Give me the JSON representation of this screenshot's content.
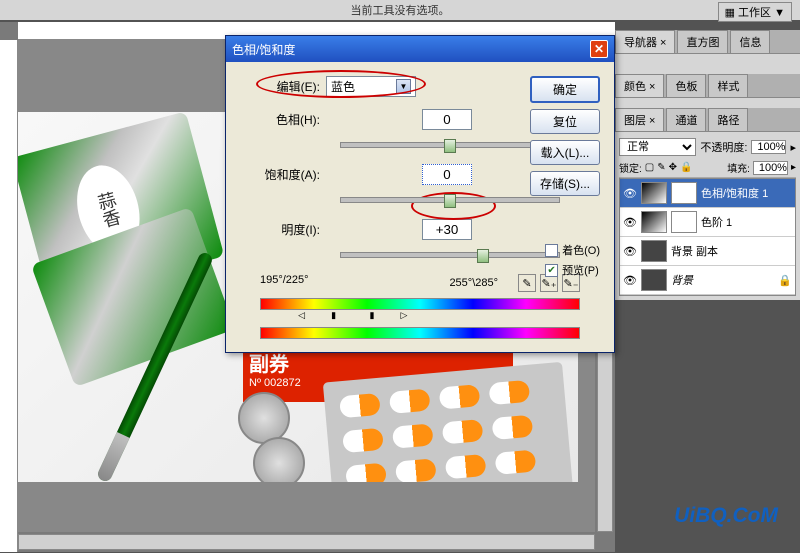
{
  "toolbar": {
    "no_options": "当前工具没有选项。",
    "workspace": "工作区 ▼"
  },
  "panel_tabs_top": [
    "导航器 ×",
    "直方图",
    "信息"
  ],
  "panel_tabs_color": [
    "颜色 ×",
    "色板",
    "样式"
  ],
  "panel_tabs_layers": [
    "图层 ×",
    "通道",
    "路径"
  ],
  "layers_panel": {
    "blend_mode": "正常",
    "opacity_label": "不透明度:",
    "opacity": "100%",
    "lock_label": "锁定:",
    "fill_label": "填充:",
    "fill": "100%",
    "layers": [
      {
        "name": "色相/饱和度 1",
        "selected": true,
        "adj": true
      },
      {
        "name": "色阶 1",
        "selected": false,
        "adj": true
      },
      {
        "name": "背景 副本",
        "selected": false,
        "adj": false
      },
      {
        "name": "背景",
        "selected": false,
        "adj": false,
        "locked": true
      }
    ]
  },
  "dialog": {
    "title": "色相/饱和度",
    "edit_label": "编辑(E):",
    "edit_value": "蓝色",
    "hue_label": "色相(H):",
    "hue_value": "0",
    "sat_label": "饱和度(A):",
    "sat_value": "0",
    "light_label": "明度(I):",
    "light_value": "+30",
    "range_left": "195°/225°",
    "range_right": "255°\\285°",
    "ok": "确定",
    "cancel": "复位",
    "load": "载入(L)...",
    "save": "存储(S)...",
    "colorize": "着色(O)",
    "preview": "预览(P)",
    "preview_checked": true
  },
  "image_text": {
    "packet_label": "蒜香",
    "red_card_title": "副券",
    "red_card_num": "Nº 002872"
  },
  "watermark": "UiBQ.CoM"
}
